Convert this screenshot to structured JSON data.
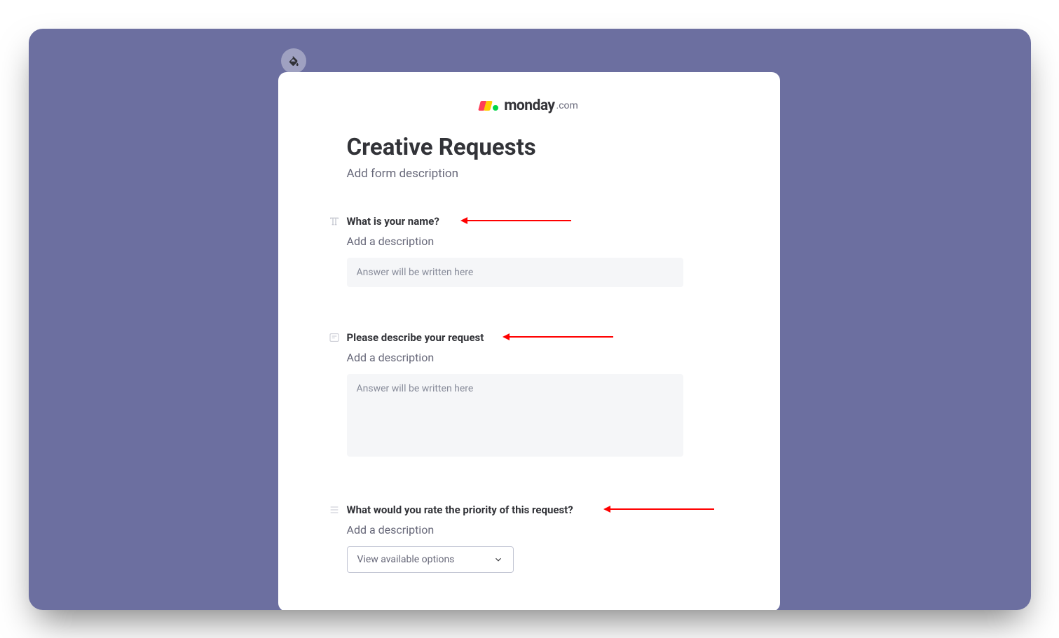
{
  "brand": {
    "name": "monday",
    "suffix": ".com"
  },
  "form": {
    "title": "Creative Requests",
    "description_placeholder": "Add form description"
  },
  "questions": {
    "q1": {
      "label": "What is your name?",
      "description_placeholder": "Add a description",
      "answer_placeholder": "Answer will be written here"
    },
    "q2": {
      "label": "Please describe your request",
      "description_placeholder": "Add a description",
      "answer_placeholder": "Answer will be written here"
    },
    "q3": {
      "label": "What would you rate the priority of this request?",
      "description_placeholder": "Add a description",
      "select_placeholder": "View available options"
    }
  }
}
